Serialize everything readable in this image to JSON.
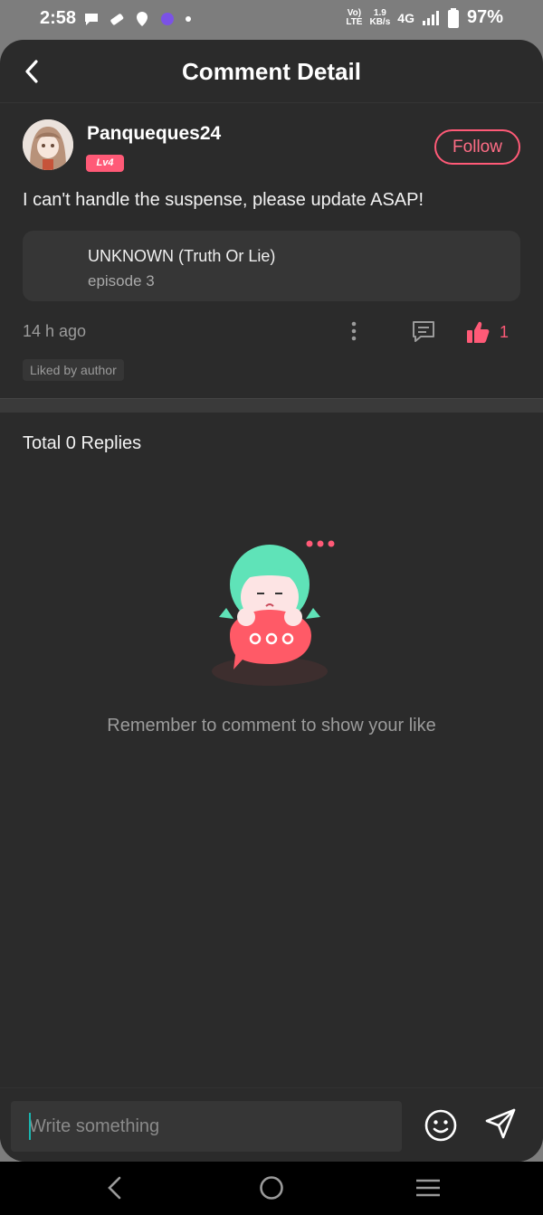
{
  "status_bar": {
    "time": "2:58",
    "network_top": "Vo)",
    "network_bottom": "LTE",
    "speed_value": "1.9",
    "speed_unit": "KB/s",
    "network_type": "4G",
    "battery": "97%"
  },
  "header": {
    "title": "Comment Detail"
  },
  "comment": {
    "username": "Panqueques24",
    "level": "Lv4",
    "follow_label": "Follow",
    "text": "I can't handle the suspense, please update ASAP!",
    "episode_title": "UNKNOWN (Truth Or Lie)",
    "episode_subtitle": "episode 3",
    "time_ago": "14 h ago",
    "like_count": "1",
    "liked_tag": "Liked by author"
  },
  "replies": {
    "title": "Total 0 Replies",
    "empty_message": "Remember to comment to show your like"
  },
  "composer": {
    "placeholder": "Write something"
  },
  "colors": {
    "accent": "#ff5a77",
    "background": "#2b2b2b",
    "card": "#363636",
    "illustration_hair": "#5fe3b8"
  },
  "icons": [
    "back-arrow-icon",
    "more-vertical-icon",
    "comment-icon",
    "thumbs-up-icon",
    "emoji-icon",
    "send-icon",
    "nav-back-icon",
    "nav-home-icon",
    "nav-menu-icon"
  ]
}
